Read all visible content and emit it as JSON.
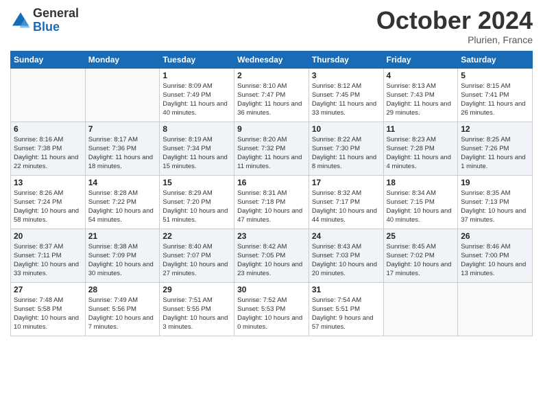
{
  "logo": {
    "general": "General",
    "blue": "Blue"
  },
  "header": {
    "month": "October 2024",
    "location": "Plurien, France"
  },
  "weekdays": [
    "Sunday",
    "Monday",
    "Tuesday",
    "Wednesday",
    "Thursday",
    "Friday",
    "Saturday"
  ],
  "weeks": [
    [
      {
        "day": "",
        "info": ""
      },
      {
        "day": "",
        "info": ""
      },
      {
        "day": "1",
        "info": "Sunrise: 8:09 AM\nSunset: 7:49 PM\nDaylight: 11 hours and 40 minutes."
      },
      {
        "day": "2",
        "info": "Sunrise: 8:10 AM\nSunset: 7:47 PM\nDaylight: 11 hours and 36 minutes."
      },
      {
        "day": "3",
        "info": "Sunrise: 8:12 AM\nSunset: 7:45 PM\nDaylight: 11 hours and 33 minutes."
      },
      {
        "day": "4",
        "info": "Sunrise: 8:13 AM\nSunset: 7:43 PM\nDaylight: 11 hours and 29 minutes."
      },
      {
        "day": "5",
        "info": "Sunrise: 8:15 AM\nSunset: 7:41 PM\nDaylight: 11 hours and 26 minutes."
      }
    ],
    [
      {
        "day": "6",
        "info": "Sunrise: 8:16 AM\nSunset: 7:38 PM\nDaylight: 11 hours and 22 minutes."
      },
      {
        "day": "7",
        "info": "Sunrise: 8:17 AM\nSunset: 7:36 PM\nDaylight: 11 hours and 18 minutes."
      },
      {
        "day": "8",
        "info": "Sunrise: 8:19 AM\nSunset: 7:34 PM\nDaylight: 11 hours and 15 minutes."
      },
      {
        "day": "9",
        "info": "Sunrise: 8:20 AM\nSunset: 7:32 PM\nDaylight: 11 hours and 11 minutes."
      },
      {
        "day": "10",
        "info": "Sunrise: 8:22 AM\nSunset: 7:30 PM\nDaylight: 11 hours and 8 minutes."
      },
      {
        "day": "11",
        "info": "Sunrise: 8:23 AM\nSunset: 7:28 PM\nDaylight: 11 hours and 4 minutes."
      },
      {
        "day": "12",
        "info": "Sunrise: 8:25 AM\nSunset: 7:26 PM\nDaylight: 11 hours and 1 minute."
      }
    ],
    [
      {
        "day": "13",
        "info": "Sunrise: 8:26 AM\nSunset: 7:24 PM\nDaylight: 10 hours and 58 minutes."
      },
      {
        "day": "14",
        "info": "Sunrise: 8:28 AM\nSunset: 7:22 PM\nDaylight: 10 hours and 54 minutes."
      },
      {
        "day": "15",
        "info": "Sunrise: 8:29 AM\nSunset: 7:20 PM\nDaylight: 10 hours and 51 minutes."
      },
      {
        "day": "16",
        "info": "Sunrise: 8:31 AM\nSunset: 7:18 PM\nDaylight: 10 hours and 47 minutes."
      },
      {
        "day": "17",
        "info": "Sunrise: 8:32 AM\nSunset: 7:17 PM\nDaylight: 10 hours and 44 minutes."
      },
      {
        "day": "18",
        "info": "Sunrise: 8:34 AM\nSunset: 7:15 PM\nDaylight: 10 hours and 40 minutes."
      },
      {
        "day": "19",
        "info": "Sunrise: 8:35 AM\nSunset: 7:13 PM\nDaylight: 10 hours and 37 minutes."
      }
    ],
    [
      {
        "day": "20",
        "info": "Sunrise: 8:37 AM\nSunset: 7:11 PM\nDaylight: 10 hours and 33 minutes."
      },
      {
        "day": "21",
        "info": "Sunrise: 8:38 AM\nSunset: 7:09 PM\nDaylight: 10 hours and 30 minutes."
      },
      {
        "day": "22",
        "info": "Sunrise: 8:40 AM\nSunset: 7:07 PM\nDaylight: 10 hours and 27 minutes."
      },
      {
        "day": "23",
        "info": "Sunrise: 8:42 AM\nSunset: 7:05 PM\nDaylight: 10 hours and 23 minutes."
      },
      {
        "day": "24",
        "info": "Sunrise: 8:43 AM\nSunset: 7:03 PM\nDaylight: 10 hours and 20 minutes."
      },
      {
        "day": "25",
        "info": "Sunrise: 8:45 AM\nSunset: 7:02 PM\nDaylight: 10 hours and 17 minutes."
      },
      {
        "day": "26",
        "info": "Sunrise: 8:46 AM\nSunset: 7:00 PM\nDaylight: 10 hours and 13 minutes."
      }
    ],
    [
      {
        "day": "27",
        "info": "Sunrise: 7:48 AM\nSunset: 5:58 PM\nDaylight: 10 hours and 10 minutes."
      },
      {
        "day": "28",
        "info": "Sunrise: 7:49 AM\nSunset: 5:56 PM\nDaylight: 10 hours and 7 minutes."
      },
      {
        "day": "29",
        "info": "Sunrise: 7:51 AM\nSunset: 5:55 PM\nDaylight: 10 hours and 3 minutes."
      },
      {
        "day": "30",
        "info": "Sunrise: 7:52 AM\nSunset: 5:53 PM\nDaylight: 10 hours and 0 minutes."
      },
      {
        "day": "31",
        "info": "Sunrise: 7:54 AM\nSunset: 5:51 PM\nDaylight: 9 hours and 57 minutes."
      },
      {
        "day": "",
        "info": ""
      },
      {
        "day": "",
        "info": ""
      }
    ]
  ]
}
